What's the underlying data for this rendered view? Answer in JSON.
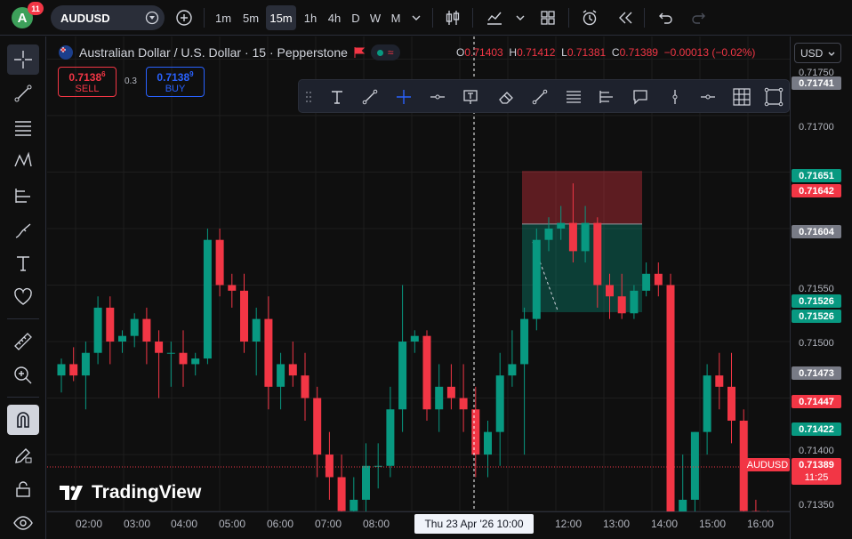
{
  "topbar": {
    "notifications": "11",
    "avatar_letter": "A",
    "symbol": "AUDUSD",
    "intervals": [
      "1m",
      "5m",
      "15m",
      "1h",
      "4h",
      "D",
      "W",
      "M"
    ],
    "active_interval": "15m"
  },
  "legend": {
    "title": "Australian Dollar / U.S. Dollar · 15 · Pepperstone",
    "open_label": "O",
    "open": "0.71403",
    "high_label": "H",
    "high": "0.71412",
    "low_label": "L",
    "low": "0.71381",
    "close_label": "C",
    "close": "0.71389",
    "change": "−0.00013 (−0.02%)"
  },
  "trade": {
    "sell_price": "0.7138",
    "sell_sup": "6",
    "sell_label": "SELL",
    "spread": "0.3",
    "buy_price": "0.7138",
    "buy_sup": "9",
    "buy_label": "BUY"
  },
  "currency": "USD",
  "price_scale": {
    "ticks": [
      "0.71750",
      "0.71700",
      "0.71550",
      "0.71500",
      "0.71400",
      "0.71350"
    ],
    "labels": [
      {
        "text": "0.71741",
        "color": "#787b86"
      },
      {
        "text": "0.71651",
        "color": "#089981"
      },
      {
        "text": "0.71642",
        "color": "#f23645"
      },
      {
        "text": "0.71604",
        "color": "#787b86"
      },
      {
        "text": "0.71526",
        "color": "#089981"
      },
      {
        "text": "0.71526",
        "color": "#089981"
      },
      {
        "text": "0.71473",
        "color": "#787b86"
      },
      {
        "text": "0.71447",
        "color": "#f23645"
      },
      {
        "text": "0.71422",
        "color": "#089981"
      },
      {
        "text": "0.71389",
        "color": "#f23645"
      }
    ],
    "symbol_tag": "AUDUSD",
    "countdown": "11:25"
  },
  "time_scale": {
    "ticks": [
      "02:00",
      "03:00",
      "04:00",
      "05:00",
      "06:00",
      "07:00",
      "08:00",
      "12:00",
      "13:00",
      "14:00",
      "15:00",
      "16:00"
    ],
    "crosshair": "Thu 23 Apr '26   10:00"
  },
  "brand": "TradingView",
  "colors": {
    "up": "#089981",
    "down": "#f23645",
    "background": "#0f0f0f",
    "panel": "#1e222d"
  },
  "chart_data": {
    "type": "candlestick",
    "symbol": "AUDUSD",
    "interval": "15",
    "ylim": [
      0.7133,
      0.7177
    ],
    "candles": [
      [
        0.7147,
        0.71485,
        0.71455,
        0.7148
      ],
      [
        0.7148,
        0.71495,
        0.71465,
        0.7147
      ],
      [
        0.7147,
        0.715,
        0.7144,
        0.7149
      ],
      [
        0.7149,
        0.7154,
        0.7148,
        0.7153
      ],
      [
        0.7153,
        0.7154,
        0.7148,
        0.715
      ],
      [
        0.715,
        0.7151,
        0.7149,
        0.71505
      ],
      [
        0.71505,
        0.71525,
        0.71495,
        0.7152
      ],
      [
        0.7152,
        0.7153,
        0.7148,
        0.715
      ],
      [
        0.715,
        0.7151,
        0.7145,
        0.7149
      ],
      [
        0.7149,
        0.715,
        0.7146,
        0.7149
      ],
      [
        0.7149,
        0.7151,
        0.7146,
        0.7148
      ],
      [
        0.7148,
        0.7149,
        0.7147,
        0.71485
      ],
      [
        0.71485,
        0.716,
        0.7148,
        0.7159
      ],
      [
        0.7159,
        0.716,
        0.7154,
        0.7155
      ],
      [
        0.7155,
        0.7156,
        0.7153,
        0.71545
      ],
      [
        0.71545,
        0.7156,
        0.7149,
        0.715
      ],
      [
        0.715,
        0.7153,
        0.7147,
        0.7152
      ],
      [
        0.7152,
        0.7154,
        0.7144,
        0.7146
      ],
      [
        0.7146,
        0.7149,
        0.7144,
        0.7148
      ],
      [
        0.7148,
        0.715,
        0.7146,
        0.7147
      ],
      [
        0.7147,
        0.7149,
        0.7143,
        0.7145
      ],
      [
        0.7145,
        0.7146,
        0.7138,
        0.714
      ],
      [
        0.714,
        0.7142,
        0.7136,
        0.7138
      ],
      [
        0.7138,
        0.714,
        0.7133,
        0.7135
      ],
      [
        0.7135,
        0.7138,
        0.7134,
        0.7136
      ],
      [
        0.7136,
        0.7141,
        0.7133,
        0.7139
      ],
      [
        0.7139,
        0.7141,
        0.7137,
        0.7139
      ],
      [
        0.7139,
        0.7146,
        0.7138,
        0.7144
      ],
      [
        0.7144,
        0.7155,
        0.7142,
        0.715
      ],
      [
        0.715,
        0.7151,
        0.7149,
        0.71505
      ],
      [
        0.71505,
        0.7151,
        0.7143,
        0.7144
      ],
      [
        0.7144,
        0.7148,
        0.7142,
        0.7146
      ],
      [
        0.7146,
        0.7148,
        0.7144,
        0.7145
      ],
      [
        0.7145,
        0.7148,
        0.7142,
        0.7144
      ],
      [
        0.7144,
        0.7146,
        0.7138,
        0.714
      ],
      [
        0.714,
        0.7143,
        0.7138,
        0.7142
      ],
      [
        0.7142,
        0.7149,
        0.7139,
        0.7147
      ],
      [
        0.7147,
        0.7151,
        0.7146,
        0.7148
      ],
      [
        0.7148,
        0.7153,
        0.714,
        0.7152
      ],
      [
        0.7152,
        0.716,
        0.7151,
        0.7159
      ],
      [
        0.7159,
        0.7161,
        0.7158,
        0.716
      ],
      [
        0.716,
        0.7162,
        0.7159,
        0.71605
      ],
      [
        0.71605,
        0.7164,
        0.7157,
        0.7158
      ],
      [
        0.7158,
        0.7162,
        0.7157,
        0.71605
      ],
      [
        0.71605,
        0.7161,
        0.7153,
        0.7155
      ],
      [
        0.7155,
        0.7156,
        0.7152,
        0.7154
      ],
      [
        0.7154,
        0.7156,
        0.7152,
        0.71525
      ],
      [
        0.71525,
        0.7155,
        0.7152,
        0.71545
      ],
      [
        0.71545,
        0.7157,
        0.7154,
        0.7156
      ],
      [
        0.7156,
        0.7157,
        0.7154,
        0.7155
      ],
      [
        0.7155,
        0.7156,
        0.7133,
        0.7133
      ],
      [
        0.7133,
        0.714,
        0.7131,
        0.7136
      ],
      [
        0.7136,
        0.7142,
        0.7133,
        0.7142
      ],
      [
        0.7142,
        0.7148,
        0.714,
        0.7147
      ],
      [
        0.7147,
        0.7149,
        0.7144,
        0.7146
      ],
      [
        0.7146,
        0.7149,
        0.7141,
        0.7143
      ],
      [
        0.7143,
        0.7144,
        0.7134,
        0.7135
      ],
      [
        0.7135,
        0.7136,
        0.7133,
        0.71345
      ],
      [
        0.71345,
        0.7135,
        0.7133,
        0.7134
      ]
    ],
    "position_tool": {
      "entry": 0.71604,
      "stop": 0.71651,
      "target": 0.71526
    }
  }
}
